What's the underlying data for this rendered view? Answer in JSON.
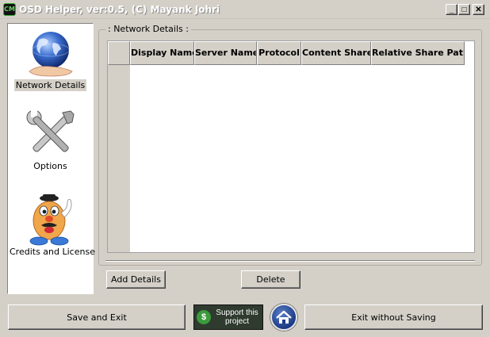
{
  "window": {
    "title": "OSD Helper, ver:0.5, (C) Mayank Johri",
    "app_icon_text": "CM",
    "minimize_symbol": "_",
    "maximize_symbol": "□",
    "close_symbol": "✕"
  },
  "sidebar": {
    "items": [
      {
        "label": "Network Details",
        "icon": "globe-hand-icon",
        "selected": true
      },
      {
        "label": "Options",
        "icon": "tools-icon",
        "selected": false
      },
      {
        "label": "Credits and License",
        "icon": "potato-head-icon",
        "selected": false
      }
    ]
  },
  "network_details": {
    "group_title": ": Network Details :",
    "columns": [
      "Display Name",
      "Server Name",
      "Protocol",
      "Content Share",
      "Relative Share Path"
    ],
    "rows": [],
    "add_label": "Add Details",
    "delete_label": "Delete"
  },
  "footer": {
    "save_label": "Save and Exit",
    "support_label": "Support this project",
    "exit_label": "Exit without Saving"
  },
  "colors": {
    "window_bg": "#d4d0c8",
    "sidebar_bg": "#ffffff",
    "home_button": "#1b3a86"
  }
}
